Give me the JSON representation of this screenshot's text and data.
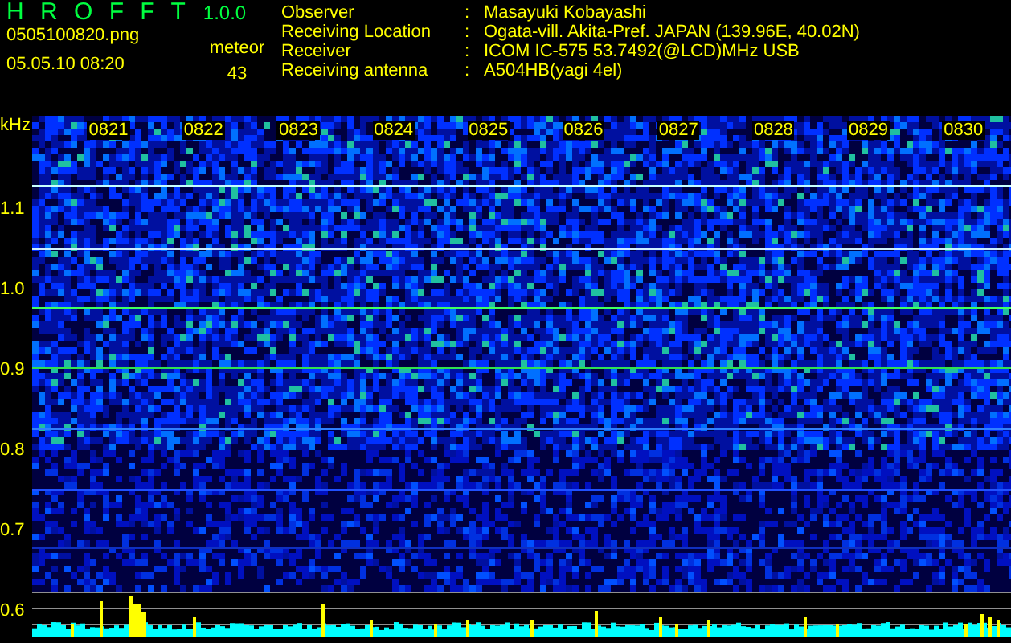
{
  "header": {
    "app_name": "H R O F F T",
    "version": "1.0.0",
    "file_name": "0505100820.png",
    "datetime": "05.05.10 08:20",
    "counter_label": "meteor",
    "counter_value": "43"
  },
  "info": [
    {
      "label": "Observer",
      "colon": ":",
      "value": "Masayuki Kobayashi"
    },
    {
      "label": "Receiving Location",
      "colon": ":",
      "value": "Ogata-vill. Akita-Pref. JAPAN (139.96E, 40.02N)"
    },
    {
      "label": "Receiver",
      "colon": ":",
      "value": "ICOM IC-575 53.7492(@LCD)MHz USB"
    },
    {
      "label": "Receiving antenna",
      "colon": ":",
      "value": "A504HB(yagi 4el)"
    }
  ],
  "spectrogram": {
    "unit": "kHz",
    "freq_labels": [
      "1.1",
      "1.0",
      "0.9",
      "0.8",
      "0.7",
      "0.6"
    ],
    "time_labels": [
      "0821",
      "0822",
      "0823",
      "0824",
      "0825",
      "0826",
      "0827",
      "0828",
      "0829",
      "0830"
    ]
  }
}
